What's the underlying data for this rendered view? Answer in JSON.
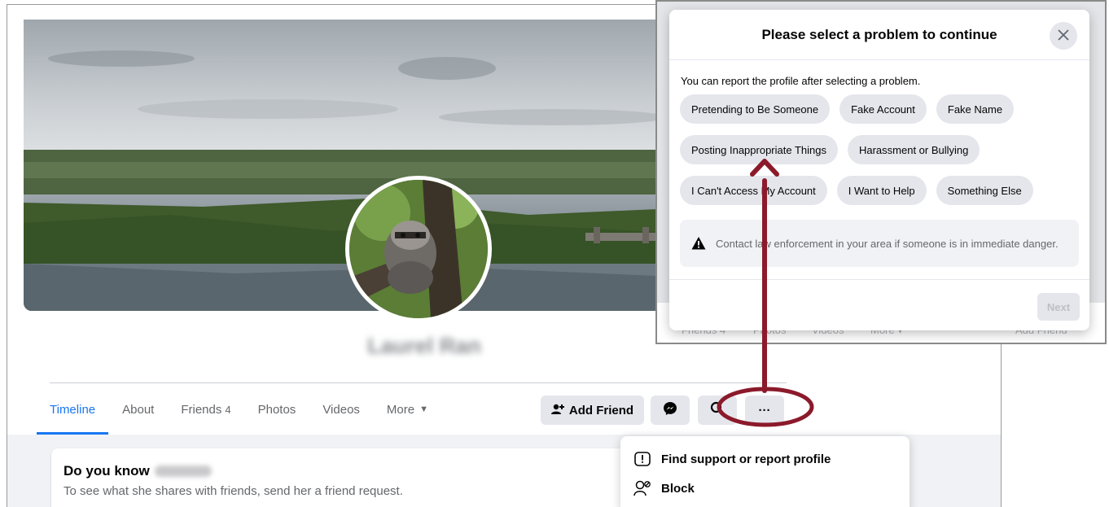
{
  "profile": {
    "name": "Laurel Ran",
    "tabs": [
      {
        "label": "Timeline"
      },
      {
        "label": "About"
      },
      {
        "label": "Friends",
        "count": "4"
      },
      {
        "label": "Photos"
      },
      {
        "label": "Videos"
      },
      {
        "label": "More"
      }
    ],
    "add_friend_label": "Add Friend",
    "more_button_label": "···",
    "know_card": {
      "title": "Do you know",
      "blurred_name": "Laurel?",
      "subtitle": "To see what she shares with friends, send her a friend request."
    }
  },
  "dropdown": {
    "items": [
      {
        "label": "Find support or report profile",
        "icon": "report-icon"
      },
      {
        "label": "Block",
        "icon": "block-user-icon"
      }
    ]
  },
  "dialog": {
    "title": "Please select a problem to continue",
    "subtitle": "You can report the profile after selecting a problem.",
    "options_rows": [
      [
        "Pretending to Be Someone",
        "Fake Account",
        "Fake Name"
      ],
      [
        "Posting Inappropriate Things",
        "Harassment or Bullying"
      ],
      [
        "I Can't Access My Account",
        "I Want to Help",
        "Something Else"
      ]
    ],
    "notice": "Contact law enforcement in your area if someone is in immediate danger.",
    "next_label": "Next",
    "background_ghost": {
      "friends": "Friends 4",
      "photos": "Photos",
      "videos": "Videos",
      "more": "More ▾",
      "add_friend": "Add Friend"
    }
  },
  "colors": {
    "accent": "#1877f2",
    "annotation": "#8b1a2b"
  }
}
